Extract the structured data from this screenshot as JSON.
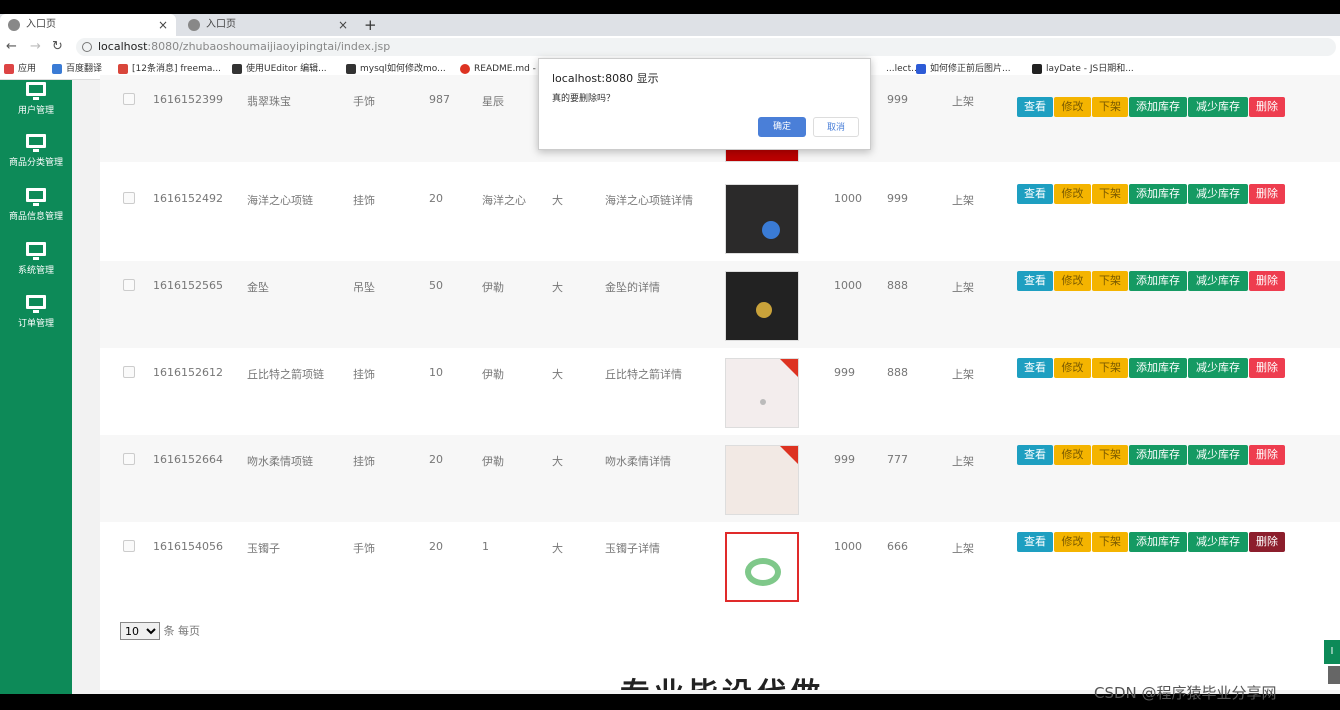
{
  "browser": {
    "tabs": [
      {
        "title": "入口页",
        "active": true
      },
      {
        "title": "入口页",
        "active": false
      }
    ],
    "url_host": "localhost",
    "url_path": ":8080/zhubaoshoumaijiaoyipingtai/index.jsp",
    "bookmarks": [
      "应用",
      "百度翻译",
      "[12条消息] freema...",
      "使用UEditor 编辑...",
      "mysql如何修改mo...",
      "README.md -",
      "...lect...",
      "如何修正前后图片...",
      "layDate - JS日期和..."
    ]
  },
  "sidebar": {
    "items": [
      {
        "label": "用户管理"
      },
      {
        "label": "商品分类管理"
      },
      {
        "label": "商品信息管理"
      },
      {
        "label": "系统管理"
      },
      {
        "label": "订单管理"
      }
    ]
  },
  "table": {
    "rows": [
      {
        "id": "1616152399",
        "name": "翡翠珠宝",
        "cat": "手饰",
        "qty": "987",
        "brand": "星辰",
        "size": "",
        "detail": "",
        "price": "",
        "price2": "999",
        "status": "上架"
      },
      {
        "id": "1616152492",
        "name": "海洋之心项链",
        "cat": "挂饰",
        "qty": "20",
        "brand": "海洋之心",
        "size": "大",
        "detail": "海洋之心项链详情",
        "price": "1000",
        "price2": "999",
        "status": "上架"
      },
      {
        "id": "1616152565",
        "name": "金坠",
        "cat": "吊坠",
        "qty": "50",
        "brand": "伊勒",
        "size": "大",
        "detail": "金坠的详情",
        "price": "1000",
        "price2": "888",
        "status": "上架"
      },
      {
        "id": "1616152612",
        "name": "丘比特之箭项链",
        "cat": "挂饰",
        "qty": "10",
        "brand": "伊勒",
        "size": "大",
        "detail": "丘比特之箭详情",
        "price": "999",
        "price2": "888",
        "status": "上架"
      },
      {
        "id": "1616152664",
        "name": "吻水柔情项链",
        "cat": "挂饰",
        "qty": "20",
        "brand": "伊勒",
        "size": "大",
        "detail": "吻水柔情详情",
        "price": "999",
        "price2": "777",
        "status": "上架"
      },
      {
        "id": "1616154056",
        "name": "玉镯子",
        "cat": "手饰",
        "qty": "20",
        "brand": "1",
        "size": "大",
        "detail": "玉镯子详情",
        "price": "1000",
        "price2": "666",
        "status": "上架"
      }
    ],
    "buttons": {
      "view": "查看",
      "edit": "修改",
      "down": "下架",
      "add_stock": "添加库存",
      "sub_stock": "减少库存",
      "delete": "删除"
    }
  },
  "pager": {
    "page_size": "10",
    "suffix": "条 每页"
  },
  "banner_text": "专业毕设代做",
  "dialog": {
    "title": "localhost:8080 显示",
    "message": "真的要删除吗？",
    "ok": "确定",
    "cancel": "取消"
  },
  "watermark": "CSDN @程序猿毕业分享网"
}
